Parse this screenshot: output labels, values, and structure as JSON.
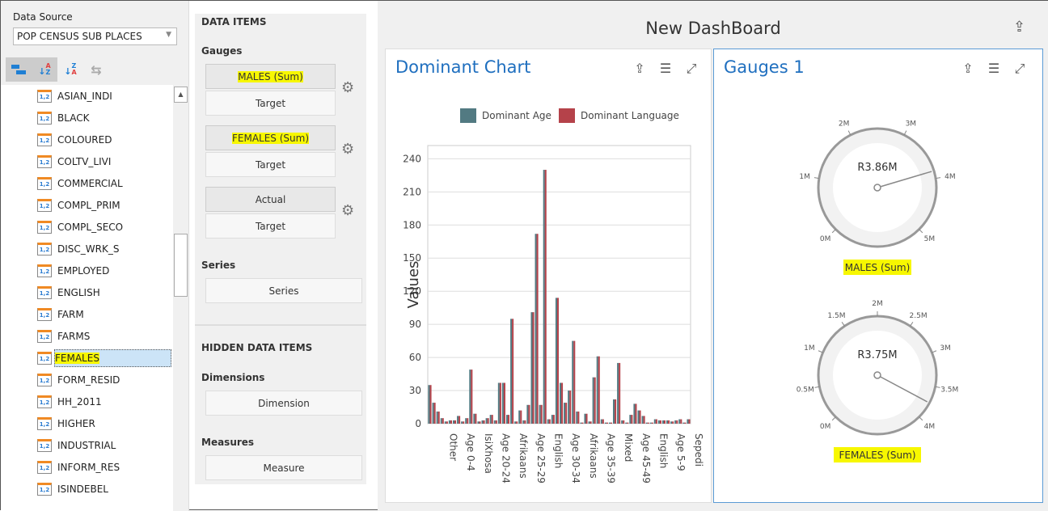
{
  "left": {
    "data_source_label": "Data Source",
    "data_source_value": "POP CENSUS SUB PLACES",
    "tools": [
      {
        "icon": "group-by-type-icon",
        "active": true
      },
      {
        "icon": "sort-a-z-icon",
        "active": true
      },
      {
        "icon": "sort-z-a-icon",
        "active": false
      },
      {
        "icon": "swap-icon",
        "active": false
      }
    ],
    "fields": [
      "ASIAN_INDI",
      "BLACK",
      "COLOURED",
      "COLTV_LIVI",
      "COMMERCIAL",
      "COMPL_PRIM",
      "COMPL_SECO",
      "DISC_WRK_S",
      "EMPLOYED",
      "ENGLISH",
      "FARM",
      "FARMS",
      "FEMALES",
      "FORM_RESID",
      "HH_2011",
      "HIGHER",
      "INDUSTRIAL",
      "INFORM_RES",
      "ISINDEBEL"
    ],
    "selected_field": "FEMALES",
    "field_type_icon": "1,2"
  },
  "data_items": {
    "title": "DATA ITEMS",
    "gauges_label": "Gauges",
    "gauges": [
      {
        "actual": "MALES (Sum)",
        "target": "Target",
        "highlight": true
      },
      {
        "actual": "FEMALES (Sum)",
        "target": "Target",
        "highlight": true
      },
      {
        "actual": "Actual",
        "target": "Target",
        "highlight": false
      }
    ],
    "series_label": "Series",
    "series_well": "Series",
    "hidden_title": "HIDDEN DATA ITEMS",
    "dimensions_label": "Dimensions",
    "dimension_well": "Dimension",
    "measures_label": "Measures",
    "measure_well": "Measure"
  },
  "dashboard": {
    "title": "New DashBoard",
    "chart_card": {
      "title": "Dominant Chart"
    },
    "gauges_card": {
      "title": "Gauges 1",
      "gauges": [
        {
          "value_label": "R3.86M",
          "value": 3.86,
          "min": 0,
          "max": 5,
          "ticks": [
            "0M",
            "1M",
            "2M",
            "3M",
            "4M",
            "5M"
          ],
          "caption": "MALES (Sum)"
        },
        {
          "value_label": "R3.75M",
          "value": 3.75,
          "min": 0,
          "max": 4,
          "ticks": [
            "0M",
            "0.5M",
            "1M",
            "1.5M",
            "2M",
            "2.5M",
            "3M",
            "3.5M",
            "4M"
          ],
          "caption": "FEMALES (Sum)"
        }
      ]
    }
  },
  "chart_data": {
    "type": "bar",
    "title": "",
    "xlabel": "",
    "ylabel": "Values",
    "ylim": [
      0,
      252
    ],
    "yticks": [
      0,
      30,
      60,
      90,
      120,
      150,
      180,
      210,
      240
    ],
    "grid": true,
    "legend_placement": "top",
    "colors": [
      "#527a82",
      "#b5424a"
    ],
    "visible_x_labels": [
      "Other",
      "Age 0-4",
      "IsiXhosa",
      "Age 20-24",
      "Afrikaans",
      "Age 25-29",
      "English",
      "Age 30-34",
      "Afrikaans",
      "Age 35-39",
      "Mixed",
      "Age 45-49",
      "English",
      "Age 5-9",
      "Sepedi"
    ],
    "series": [
      {
        "name": "Dominant Age",
        "values": [
          35,
          19,
          11,
          5,
          2,
          3,
          3,
          7,
          2,
          5,
          49,
          9,
          2,
          3,
          5,
          8,
          3,
          37,
          37,
          8,
          95,
          2,
          12,
          3,
          17,
          101,
          172,
          17,
          230,
          4,
          8,
          114,
          37,
          19,
          30,
          75,
          11,
          1,
          9,
          2,
          42,
          61,
          4,
          1,
          1,
          22,
          55,
          3,
          1,
          8,
          18,
          12,
          7,
          1,
          1,
          4,
          3,
          3,
          3,
          2,
          3,
          4,
          1,
          4
        ]
      },
      {
        "name": "Dominant Language",
        "values": [
          35,
          19,
          11,
          5,
          2,
          3,
          3,
          7,
          2,
          5,
          49,
          9,
          2,
          3,
          5,
          8,
          3,
          37,
          37,
          8,
          95,
          2,
          12,
          3,
          17,
          101,
          172,
          17,
          230,
          4,
          8,
          114,
          37,
          19,
          30,
          75,
          11,
          1,
          9,
          2,
          42,
          61,
          4,
          1,
          1,
          22,
          55,
          3,
          1,
          8,
          18,
          12,
          7,
          1,
          1,
          4,
          3,
          3,
          3,
          2,
          3,
          4,
          1,
          4
        ]
      }
    ]
  }
}
